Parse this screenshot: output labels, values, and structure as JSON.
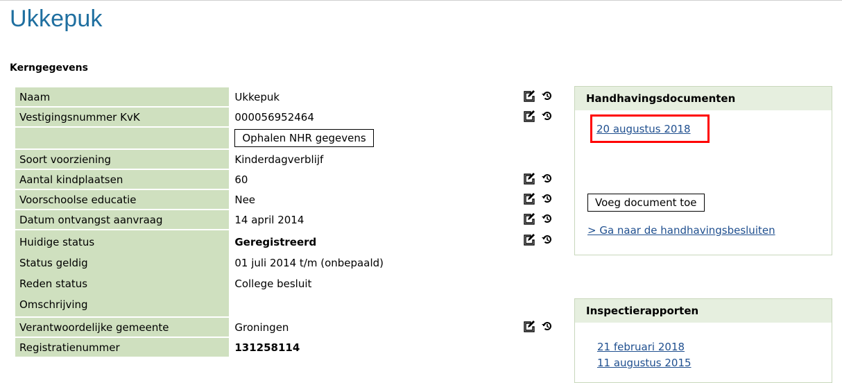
{
  "page": {
    "title": "Ukkepuk"
  },
  "kerngegevens": {
    "heading": "Kerngegevens",
    "rows": [
      {
        "label": "Naam",
        "value": "Ukkepuk"
      },
      {
        "label": "Vestigingsnummer KvK",
        "value": "000056952464"
      },
      {
        "label": "",
        "button": "Ophalen NHR gegevens"
      },
      {
        "label": "Soort voorziening",
        "value": "Kinderdagverblijf"
      },
      {
        "label": "Aantal kindplaatsen",
        "value": "60"
      },
      {
        "label": "Voorschoolse educatie",
        "value": "Nee"
      },
      {
        "label": "Datum ontvangst aanvraag",
        "value": "14 april 2014"
      }
    ],
    "status": {
      "labels": [
        "Huidige status",
        "Status geldig",
        "Reden status",
        "Omschrijving"
      ],
      "values": [
        "Geregistreerd",
        "01 juli 2014 t/m (onbepaald)",
        "College besluit",
        ""
      ]
    },
    "gemeente": {
      "label": "Verantwoordelijke gemeente",
      "value": "Groningen"
    },
    "registratie": {
      "label": "Registratienummer",
      "value": "131258114"
    }
  },
  "handhaving": {
    "header": "Handhavingsdocumenten",
    "document_link": "20 augustus 2018",
    "add_button": "Voeg document toe",
    "besluiten_link": "> Ga naar de handhavingsbesluiten"
  },
  "inspectie": {
    "header": "Inspectierapporten",
    "links": [
      "21 februari 2018",
      "11 augustus 2015"
    ]
  },
  "colors": {
    "title": "#1f6fa0",
    "label_bg": "#cfe0bf",
    "panel_header_bg": "#e6efdf",
    "link": "#1f4f8f",
    "highlight_border": "#ff0000"
  },
  "icons": {
    "edit": "edit-icon",
    "history": "history-icon"
  }
}
